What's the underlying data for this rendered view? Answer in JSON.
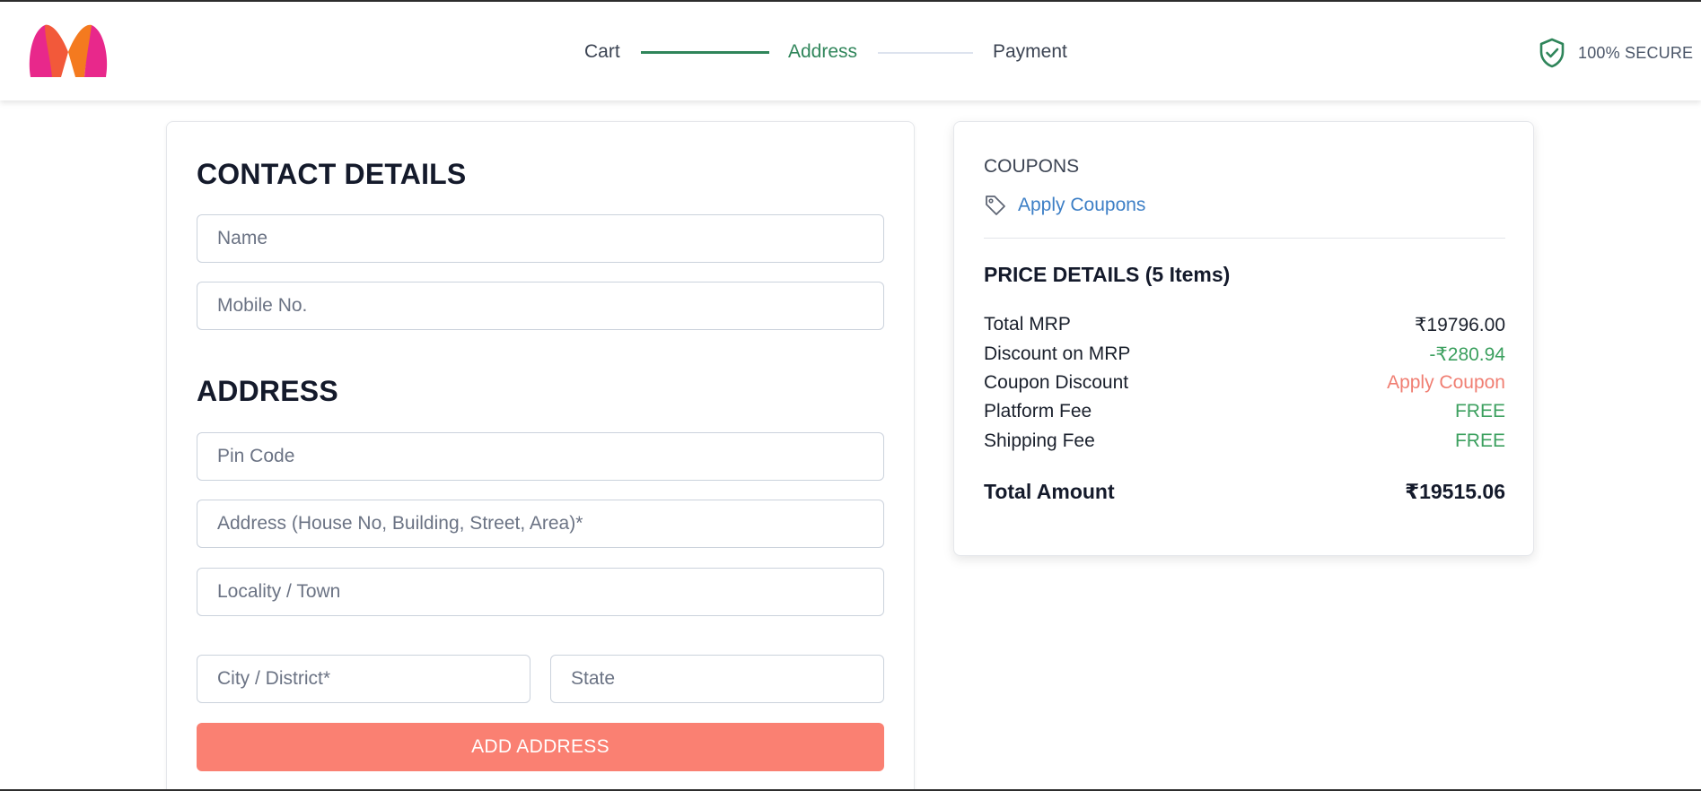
{
  "header": {
    "steps": [
      {
        "label": "Cart"
      },
      {
        "label": "Address"
      },
      {
        "label": "Payment"
      }
    ],
    "secure_label": "100% SECURE"
  },
  "contact": {
    "title": "CONTACT DETAILS",
    "name_placeholder": "Name",
    "mobile_placeholder": "Mobile No."
  },
  "address": {
    "title": "ADDRESS",
    "pin_placeholder": "Pin Code",
    "address_placeholder": "Address (House No, Building, Street, Area)*",
    "locality_placeholder": "Locality / Town",
    "city_placeholder": "City / District*",
    "state_placeholder": "State",
    "submit_label": "ADD ADDRESS"
  },
  "summary": {
    "coupons_title": "COUPONS",
    "apply_coupons_label": "Apply Coupons",
    "price_title": "PRICE DETAILS (5 Items)",
    "rows": [
      {
        "label": "Total MRP",
        "value": "₹19796.00"
      },
      {
        "label": "Discount on MRP",
        "value": "-₹280.94"
      },
      {
        "label": "Coupon Discount",
        "value": "Apply Coupon"
      },
      {
        "label": "Platform Fee",
        "value": "FREE"
      },
      {
        "label": "Shipping Fee",
        "value": "FREE"
      }
    ],
    "total_label": "Total Amount",
    "total_value": "₹19515.06"
  },
  "colors": {
    "accent_green": "#2f855a",
    "button_salmon": "#fa8072",
    "link_blue": "#3d7fc6"
  },
  "icons": {
    "logo": "myntra-logo",
    "secure": "shield-check-icon",
    "coupon": "tag-icon"
  }
}
